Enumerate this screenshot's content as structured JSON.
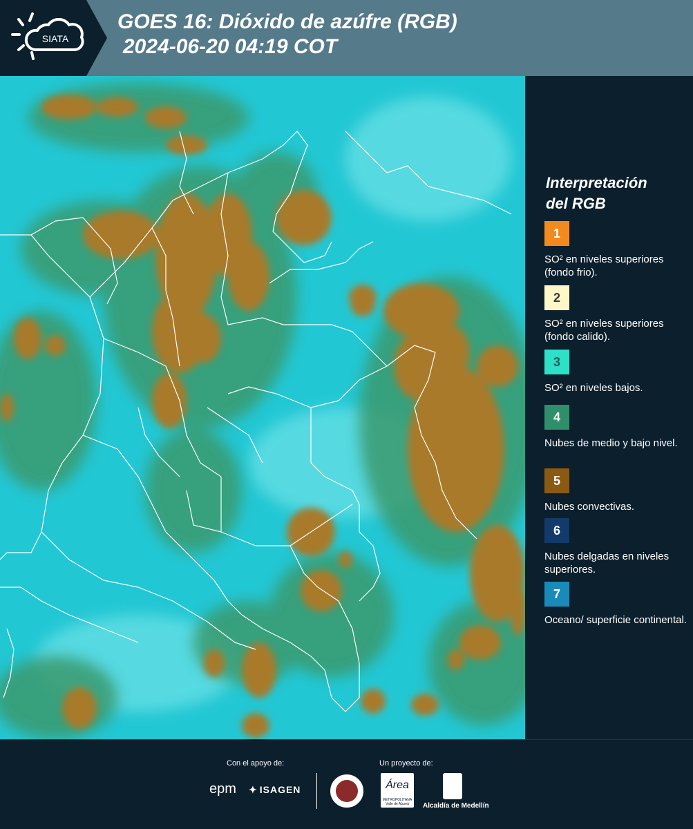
{
  "header": {
    "logo_text": "SIATA",
    "title_line1": "GOES 16: Dióxido de azúfre (RGB)",
    "title_line2": "2024-06-20 04:19 COT"
  },
  "legend": {
    "title_line1": "Interpretación",
    "title_line2": "del RGB",
    "items": [
      {
        "number": "1",
        "text": "SO² en niveles superiores (fondo frio).",
        "color": "#f28a1e",
        "num_color": "#ffffff"
      },
      {
        "number": "2",
        "text": "SO² en niveles superiores (fondo calido).",
        "color": "#fff7c8",
        "num_color": "#3a3a3a"
      },
      {
        "number": "3",
        "text": "SO² en niveles bajos.",
        "color": "#2fe0c8",
        "num_color": "#1f5f5a"
      },
      {
        "number": "4",
        "text": "Nubes de medio y bajo nivel.",
        "color": "#2f8f6a",
        "num_color": "#ffffff"
      },
      {
        "number": "5",
        "text": "Nubes convectivas.",
        "color": "#8a5a12",
        "num_color": "#ffffff"
      },
      {
        "number": "6",
        "text": "Nubes delgadas en niveles superiores.",
        "color": "#123a6a",
        "num_color": "#ffffff"
      },
      {
        "number": "7",
        "text": "Oceano/ superficie continental.",
        "color": "#1a8ab8",
        "num_color": "#ffffff"
      }
    ]
  },
  "footer": {
    "support_label": "Con el apoyo de:",
    "project_label": "Un proyecto de:",
    "epm_text": "epm",
    "isagen_text": "ISAGEN",
    "area_text": "Área",
    "area_subtext": "METROPOLITANA Valle de Aburrá",
    "alcaldia_text": "Alcaldía de Medellín"
  },
  "colors": {
    "header_bg": "#557a8a",
    "panel_bg": "#0c1f2c",
    "sea": "#22c7d4",
    "low_cloud": "#3a9a6e",
    "convective": "#a87a2a",
    "border_lines": "#ffffff"
  }
}
